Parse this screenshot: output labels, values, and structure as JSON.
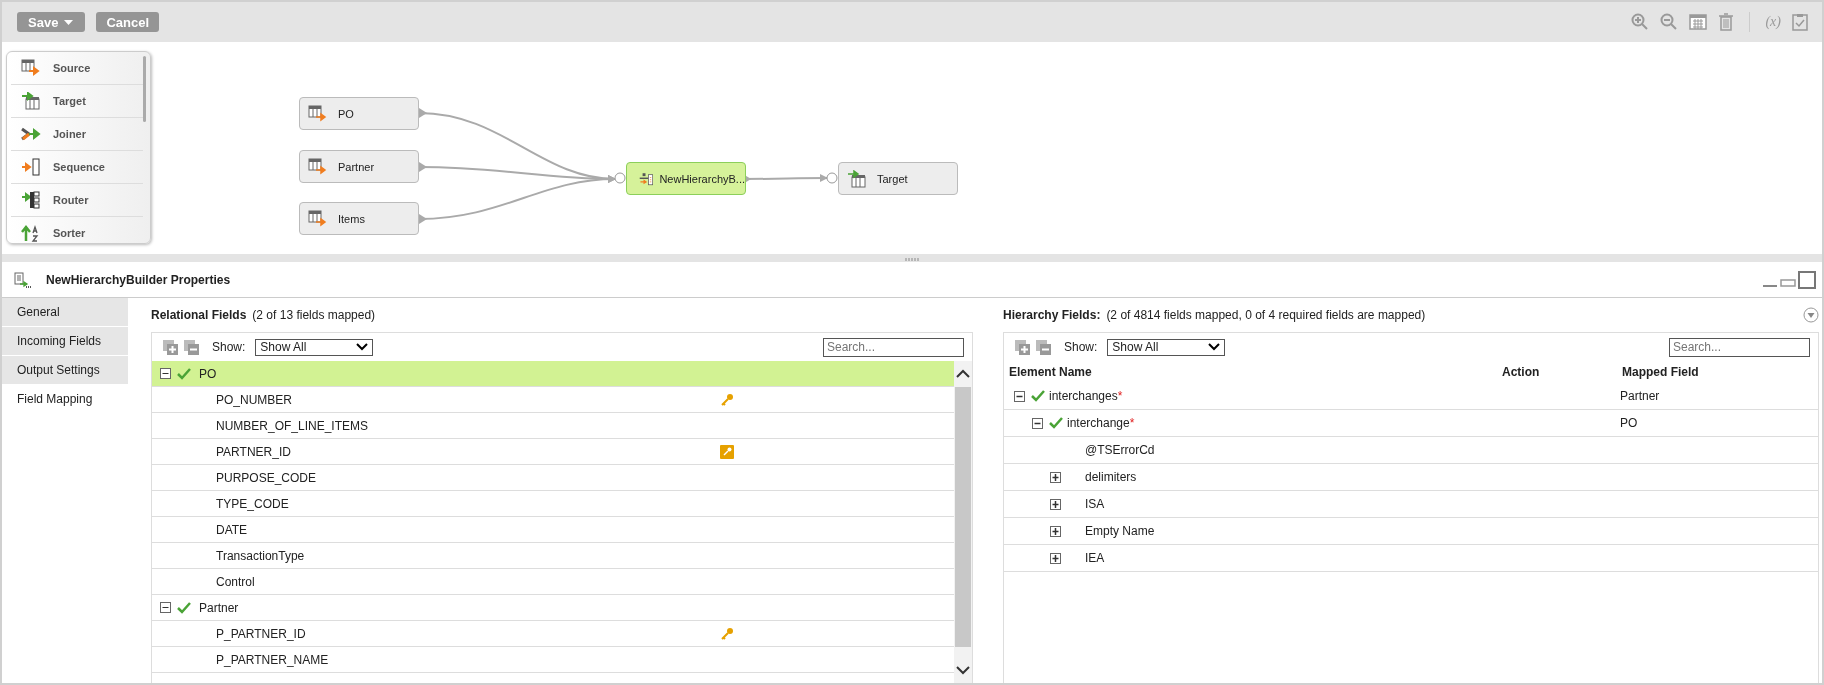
{
  "toolbar": {
    "buttons": [
      {
        "label": "Save",
        "kind": "dropdown"
      },
      {
        "label": "Cancel",
        "kind": "plain"
      }
    ],
    "formula_icon_text": "(x)"
  },
  "palette": {
    "items": [
      {
        "label": "Source",
        "kind": "source"
      },
      {
        "label": "Target",
        "kind": "target"
      },
      {
        "label": "Joiner",
        "kind": "joiner"
      },
      {
        "label": "Sequence",
        "kind": "sequence"
      },
      {
        "label": "Router",
        "kind": "router"
      },
      {
        "label": "Sorter",
        "kind": "sorter"
      }
    ]
  },
  "canvas": {
    "nodes": [
      {
        "label": "PO",
        "kind": "source",
        "selected": false
      },
      {
        "label": "Partner",
        "kind": "source",
        "selected": false
      },
      {
        "label": "Items",
        "kind": "source",
        "selected": false
      },
      {
        "label": "NewHierarchyB...",
        "kind": "hierarchy",
        "selected": true
      },
      {
        "label": "Target",
        "kind": "target",
        "selected": false
      }
    ]
  },
  "properties": {
    "title": "NewHierarchyBuilder Properties",
    "tabs": [
      {
        "label": "General",
        "selected": false
      },
      {
        "label": "Incoming Fields",
        "selected": false
      },
      {
        "label": "Output Settings",
        "selected": false
      },
      {
        "label": "Field Mapping",
        "selected": true
      }
    ],
    "relational": {
      "title": "Relational Fields",
      "summary": "(2 of 13 fields mapped)",
      "show_label": "Show:",
      "show_value": "Show All",
      "search_placeholder": "Search...",
      "groups": [
        {
          "name": "PO",
          "mapped": true,
          "expanded": true,
          "selected": true,
          "fields": [
            {
              "name": "PO_NUMBER",
              "kind": "primary_key"
            },
            {
              "name": "NUMBER_OF_LINE_ITEMS",
              "kind": "plain"
            },
            {
              "name": "PARTNER_ID",
              "kind": "foreign_key"
            },
            {
              "name": "PURPOSE_CODE",
              "kind": "plain"
            },
            {
              "name": "TYPE_CODE",
              "kind": "plain"
            },
            {
              "name": "DATE",
              "kind": "plain"
            },
            {
              "name": "TransactionType",
              "kind": "plain"
            },
            {
              "name": "Control",
              "kind": "plain"
            }
          ]
        },
        {
          "name": "Partner",
          "mapped": true,
          "expanded": true,
          "selected": false,
          "fields": [
            {
              "name": "P_PARTNER_ID",
              "kind": "primary_key"
            },
            {
              "name": "P_PARTNER_NAME",
              "kind": "plain"
            }
          ]
        }
      ]
    },
    "hierarchy": {
      "title": "Hierarchy Fields:",
      "summary": "(2 of 4814 fields mapped, 0 of 4 required fields are mapped)",
      "show_label": "Show:",
      "show_value": "Show All",
      "search_placeholder": "Search...",
      "columns": [
        "Element Name",
        "Action",
        "Mapped Field"
      ],
      "rows": [
        {
          "name": "interchanges",
          "kind": "group",
          "required_mark": "*",
          "mapped": true,
          "expanded": true,
          "mapped_field": "Partner",
          "children": [
            {
              "name": "interchange",
              "kind": "group",
              "required_mark": "*",
              "mapped": true,
              "expanded": true,
              "mapped_field": "PO",
              "children": [
                {
                  "name": "@TSErrorCd",
                  "kind": "leaf",
                  "mapped": false
                },
                {
                  "name": "delimiters",
                  "kind": "group",
                  "mapped": false,
                  "expanded": false
                },
                {
                  "name": "ISA",
                  "kind": "group",
                  "mapped": false,
                  "expanded": false
                },
                {
                  "name": "Empty Name",
                  "kind": "group",
                  "mapped": false,
                  "expanded": false
                },
                {
                  "name": "IEA",
                  "kind": "group",
                  "mapped": false,
                  "expanded": false
                }
              ]
            }
          ]
        }
      ]
    }
  }
}
